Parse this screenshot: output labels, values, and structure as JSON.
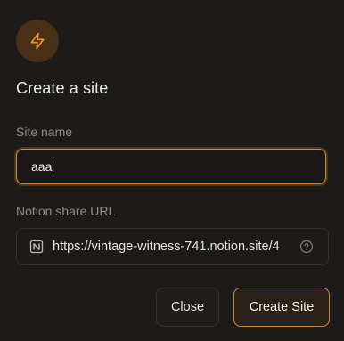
{
  "dialog": {
    "title": "Create a site",
    "icon": "lightning-bolt-icon"
  },
  "form": {
    "site_name_label": "Site name",
    "site_name_value": "aaa",
    "notion_url_label": "Notion share URL",
    "notion_url_value": "https://vintage-witness-741.notion.site/4",
    "notion_icon": "notion-logo-icon",
    "help_icon": "question-circle-icon"
  },
  "buttons": {
    "close_label": "Close",
    "create_label": "Create Site"
  },
  "colors": {
    "accent": "#d58c2f",
    "background": "#1c1b1a"
  }
}
